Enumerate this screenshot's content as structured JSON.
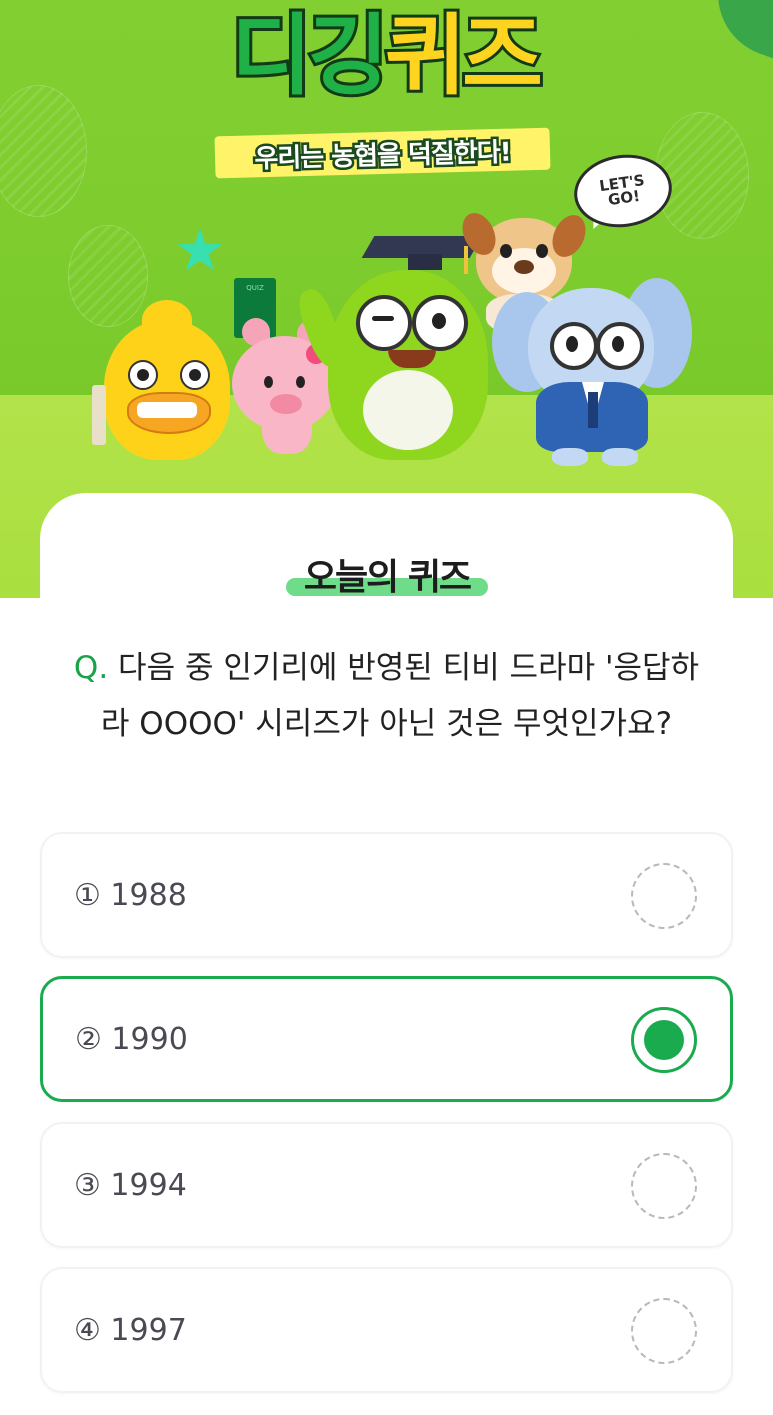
{
  "banner": {
    "title_part1": "디깅",
    "title_part2": "퀴즈",
    "subtitle": "우리는 농협을 덕질한다!",
    "speech_line1": "LET'S",
    "speech_line2": "GO!",
    "book_label": "QUIZ",
    "accent_color": "#1fb047",
    "highlight_color": "#ffd41f"
  },
  "quiz": {
    "heading": "오늘의 퀴즈",
    "question_prefix": "Q.",
    "question_text": "다음 중 인기리에 반영된 티비 드라마 '응답하라 OOOO' 시리즈가 아닌 것은 무엇인가요?",
    "selected_index": 1,
    "selected_color": "#1aab4f",
    "options": [
      {
        "label": "① 1988",
        "selected": false
      },
      {
        "label": "② 1990",
        "selected": true
      },
      {
        "label": "③ 1994",
        "selected": false
      },
      {
        "label": "④ 1997",
        "selected": false
      }
    ]
  }
}
